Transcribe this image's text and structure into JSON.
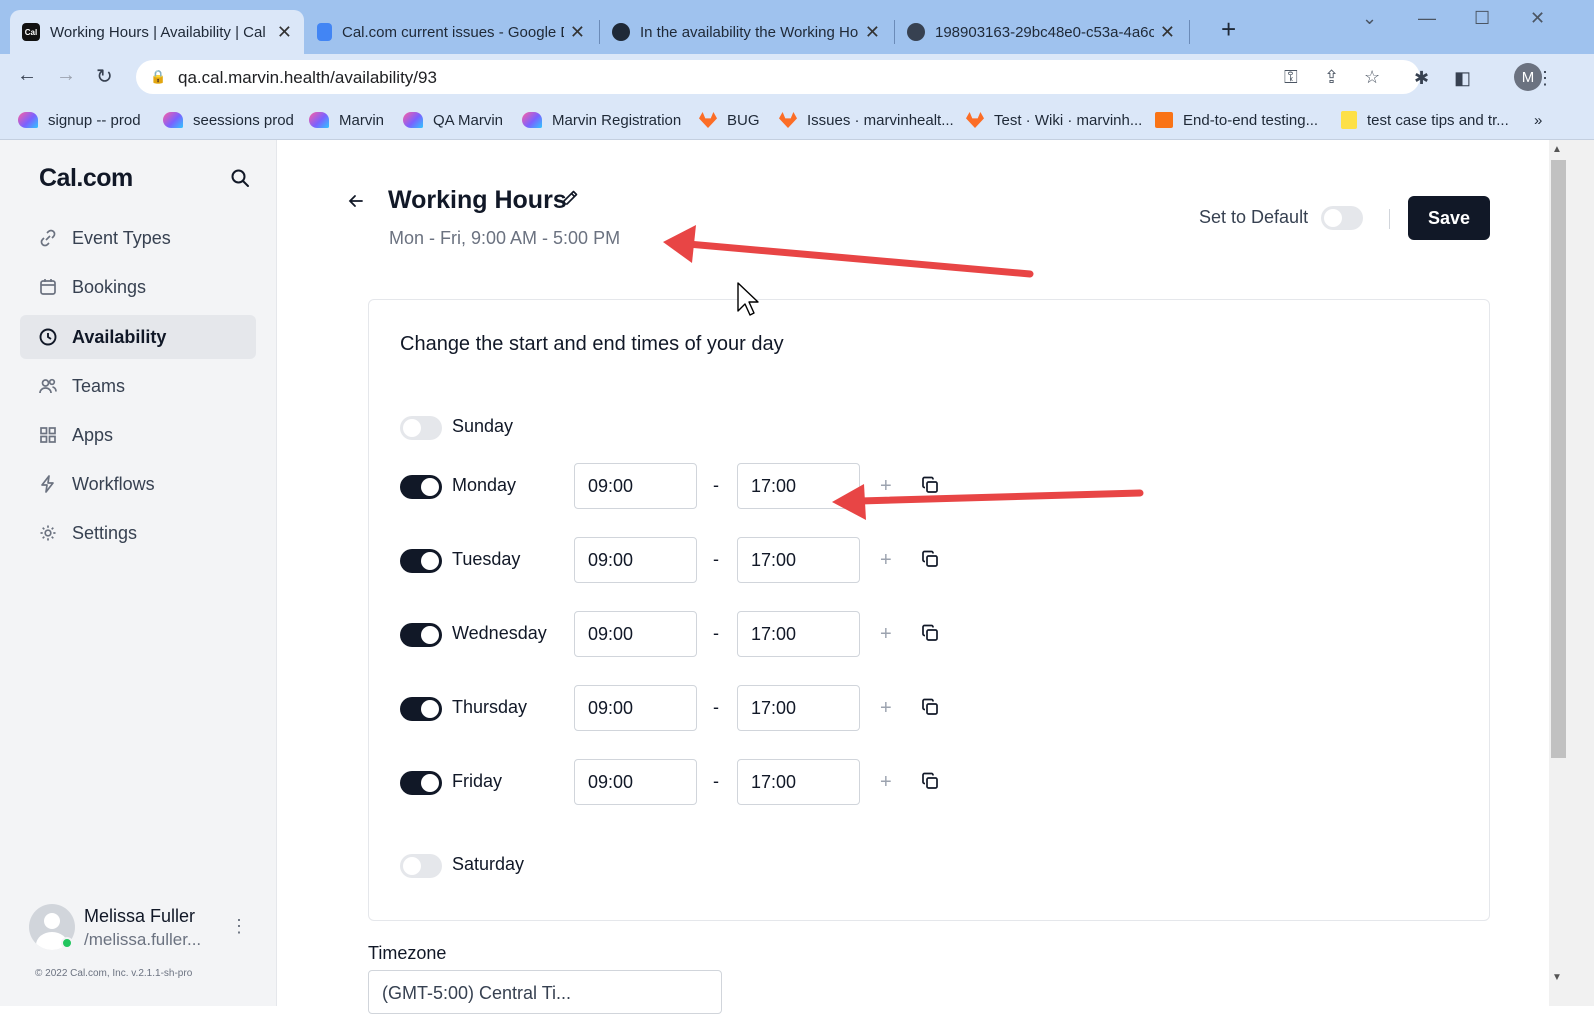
{
  "browser": {
    "tabs": [
      {
        "title": "Working Hours | Availability | Cal",
        "favicon": "cal-favicon",
        "active": true
      },
      {
        "title": "Cal.com current issues - Google D",
        "favicon": "google-docs-icon",
        "active": false
      },
      {
        "title": "In the availability the Working Ho",
        "favicon": "github-icon",
        "active": false
      },
      {
        "title": "198903163-29bc48e0-c53a-4a6c",
        "favicon": "globe-icon",
        "active": false
      }
    ],
    "url": "qa.cal.marvin.health/availability/93",
    "profile_initial": "M",
    "bookmarks": [
      {
        "label": "signup -- prod",
        "icon": "marvin-wave-icon"
      },
      {
        "label": "seessions prod",
        "icon": "marvin-wave-icon"
      },
      {
        "label": "Marvin",
        "icon": "marvin-wave-icon"
      },
      {
        "label": "QA Marvin",
        "icon": "marvin-wave-icon"
      },
      {
        "label": "Marvin Registration",
        "icon": "marvin-wave-icon"
      },
      {
        "label": "BUG",
        "icon": "gitlab-icon"
      },
      {
        "label": "Issues · marvinhealt...",
        "icon": "gitlab-icon"
      },
      {
        "label": "Test · Wiki · marvinh...",
        "icon": "gitlab-icon"
      },
      {
        "label": "End-to-end testing...",
        "icon": "box-icon"
      },
      {
        "label": "test case tips and tr...",
        "icon": "note-icon"
      }
    ]
  },
  "sidebar": {
    "logo": "Cal.com",
    "items": [
      {
        "label": "Event Types",
        "icon": "link-icon",
        "active": false
      },
      {
        "label": "Bookings",
        "icon": "calendar-icon",
        "active": false
      },
      {
        "label": "Availability",
        "icon": "clock-icon",
        "active": true
      },
      {
        "label": "Teams",
        "icon": "users-icon",
        "active": false
      },
      {
        "label": "Apps",
        "icon": "grid-icon",
        "active": false
      },
      {
        "label": "Workflows",
        "icon": "zap-icon",
        "active": false
      },
      {
        "label": "Settings",
        "icon": "gear-icon",
        "active": false
      }
    ],
    "user": {
      "name": "Melissa Fuller",
      "handle": "/melissa.fuller..."
    },
    "copyright": "© 2022 Cal.com, Inc. v.2.1.1-sh-pro"
  },
  "header": {
    "title": "Working Hours",
    "subtitle": "Mon - Fri, 9:00 AM - 5:00 PM",
    "set_default_label": "Set to Default",
    "set_default_on": false,
    "save_label": "Save"
  },
  "schedule": {
    "heading": "Change the start and end times of your day",
    "separator": "-",
    "days": [
      {
        "name": "Sunday",
        "enabled": false
      },
      {
        "name": "Monday",
        "enabled": true,
        "start": "09:00",
        "end": "17:00"
      },
      {
        "name": "Tuesday",
        "enabled": true,
        "start": "09:00",
        "end": "17:00"
      },
      {
        "name": "Wednesday",
        "enabled": true,
        "start": "09:00",
        "end": "17:00"
      },
      {
        "name": "Thursday",
        "enabled": true,
        "start": "09:00",
        "end": "17:00"
      },
      {
        "name": "Friday",
        "enabled": true,
        "start": "09:00",
        "end": "17:00"
      },
      {
        "name": "Saturday",
        "enabled": false
      }
    ]
  },
  "timezone": {
    "label": "Timezone",
    "value": "(GMT-5:00) Central Ti..."
  },
  "colors": {
    "annotation_arrow": "#e84545",
    "primary": "#111827",
    "tab_strip": "#9fc2ee"
  }
}
